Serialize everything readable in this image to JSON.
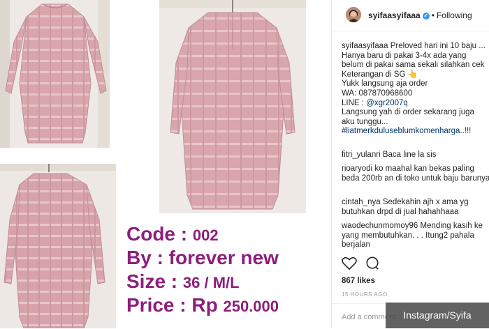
{
  "product": {
    "code_label": "Code : ",
    "code_value": "002",
    "by_label": "By : forever new",
    "size_label": "Size : ",
    "size_value": "36 / M/L",
    "price_label": "Price : Rp ",
    "price_value": "250.000",
    "text_color": "#8d1e7c"
  },
  "post": {
    "username": "syifaasyifaaa",
    "verified_icon": "verified-badge-icon",
    "dot": "•",
    "following_label": "Following",
    "caption_user": "syifaasyifaaa",
    "caption_lines": [
      "Preloved hari ini 10 baju ...",
      "Hanya baru di pakai 3-4x ada yang",
      "belum di pakai sama sekali silahkan cek",
      "Keterangan di SG",
      "Yukk langsung aja order",
      "WA: 087870968600",
      "LINE : ",
      "Langsung yah di order sekarang juga",
      "aku tunggu...",
      "#liatmerkduluseblumkomenharga..!!!"
    ],
    "line_id": "@xgr2007q",
    "likes": "867 likes",
    "timestamp": "15 HOURS AGO",
    "add_comment_placeholder": "Add a comment..."
  },
  "comments": [
    {
      "user": "fitri_yulanri",
      "text": "Baca line la sis"
    },
    {
      "user": "rioaryodi",
      "text": "ko maahal kan bekas paling beda 200rb an di toko untuk baju barunya"
    },
    {
      "user": "cintah_nya",
      "text": "Sedekahin ajh x ama yg butuhkan drpd di jual hahahhaaa"
    },
    {
      "user": "waodechunmomoy96",
      "text": "Mending kasih ke yang membutuhkan. . . Itung2 pahala berjalan"
    }
  ],
  "watermark": "Instagram/Syifa",
  "colors": {
    "dress_pink": "#d9a6ae",
    "ig_link": "#003569",
    "verified_blue": "#3897f0"
  }
}
